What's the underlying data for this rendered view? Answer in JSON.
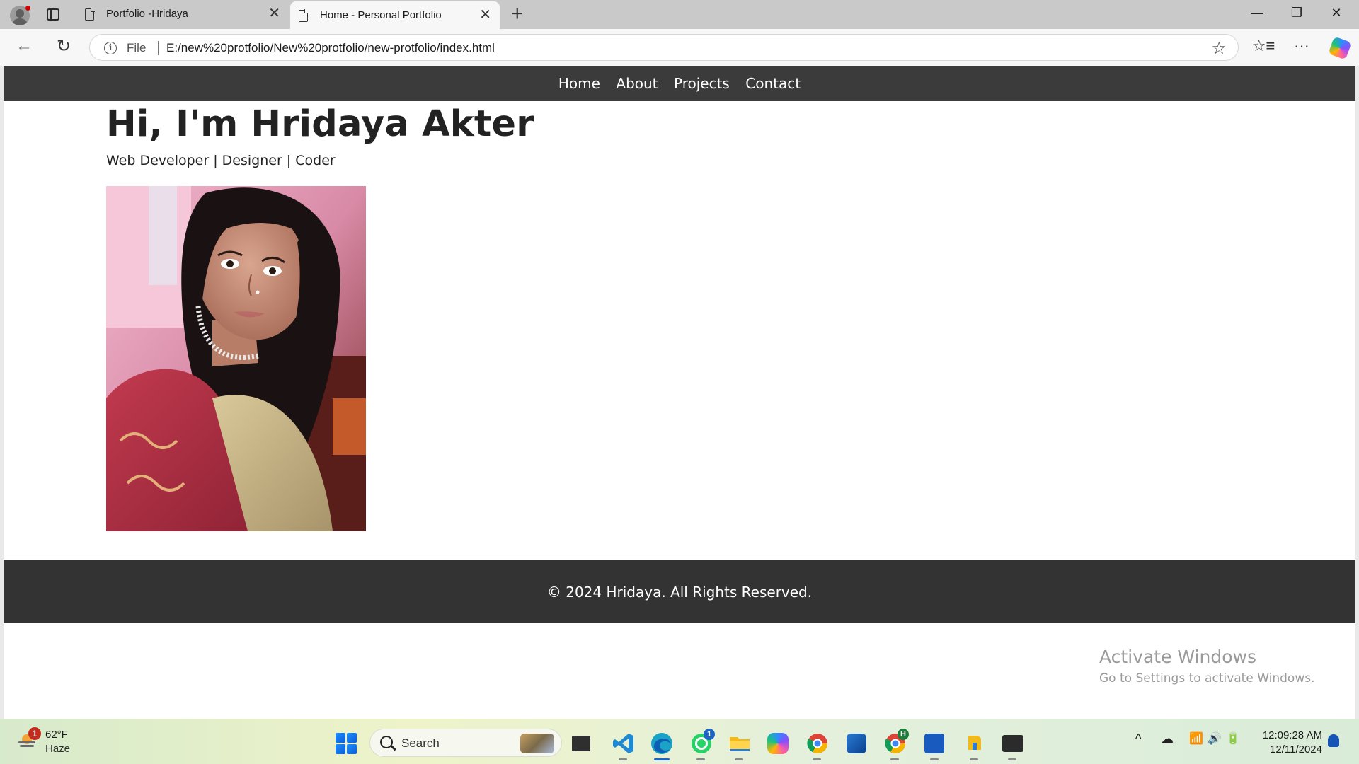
{
  "browser": {
    "tabs": [
      {
        "title": "Portfolio -Hridaya",
        "active": false
      },
      {
        "title": "Home - Personal Portfolio",
        "active": true
      }
    ],
    "address": {
      "scheme_label": "File",
      "url": "E:/new%20protfolio/New%20protfolio/new-protfolio/index.html"
    },
    "icons": {
      "profile": "profile-icon",
      "tab_actions": "tab-actions-icon",
      "new_tab": "+",
      "back": "←",
      "reload": "↻",
      "favorite": "☆",
      "favorites_bar": "☆≡",
      "more": "···",
      "minimize": "—",
      "restore": "❐",
      "close_window": "✕",
      "tab_close": "✕"
    }
  },
  "page": {
    "nav": [
      "Home",
      "About",
      "Projects",
      "Contact"
    ],
    "heading": "Hi, I'm Hridaya Akter",
    "subtitle": "Web Developer | Designer | Coder",
    "footer": "© 2024 Hridaya. All Rights Reserved."
  },
  "watermark": {
    "line1": "Activate Windows",
    "line2": "Go to Settings to activate Windows."
  },
  "taskbar": {
    "weather": {
      "temp": "62°F",
      "condition": "Haze",
      "badge": "1"
    },
    "search_placeholder": "Search",
    "whatsapp_badge": "1",
    "chrome_profile_badge": "H",
    "tray_icons": [
      "^",
      "☁",
      "📶",
      "🔊",
      "🔋"
    ],
    "time": "12:09:28 AM",
    "date": "12/11/2024"
  },
  "colors": {
    "site_nav_bg": "#3b3b3b",
    "site_footer_bg": "#333333",
    "heading_text": "#222222",
    "watermark": "#9a9a9a"
  }
}
